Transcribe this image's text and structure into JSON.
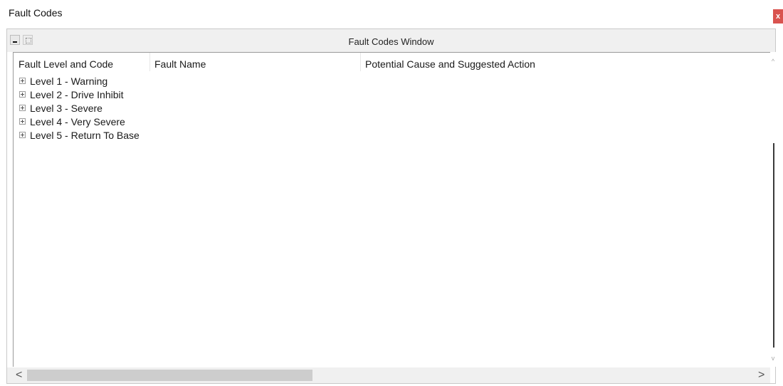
{
  "window": {
    "title": "Fault Codes",
    "close_label": "x"
  },
  "panel": {
    "title": "Fault Codes Window",
    "icons": [
      "minimize-icon",
      "panel-config-icon"
    ]
  },
  "grid": {
    "columns": [
      "Fault Level and Code",
      "Fault Name",
      "Potential Cause and Suggested Action"
    ],
    "rows": [
      {
        "label": "Level 1 - Warning",
        "expander": "plus"
      },
      {
        "label": "Level 2 - Drive Inhibit",
        "expander": "plus"
      },
      {
        "label": "Level 3 - Severe",
        "expander": "plus"
      },
      {
        "label": "Level 4 - Very Severe",
        "expander": "plus"
      },
      {
        "label": "Level 5 - Return To Base",
        "expander": "plus"
      }
    ]
  },
  "scrollbars": {
    "vertical_up": "^",
    "vertical_down": "v",
    "horizontal_left": "<",
    "horizontal_right": ">"
  }
}
